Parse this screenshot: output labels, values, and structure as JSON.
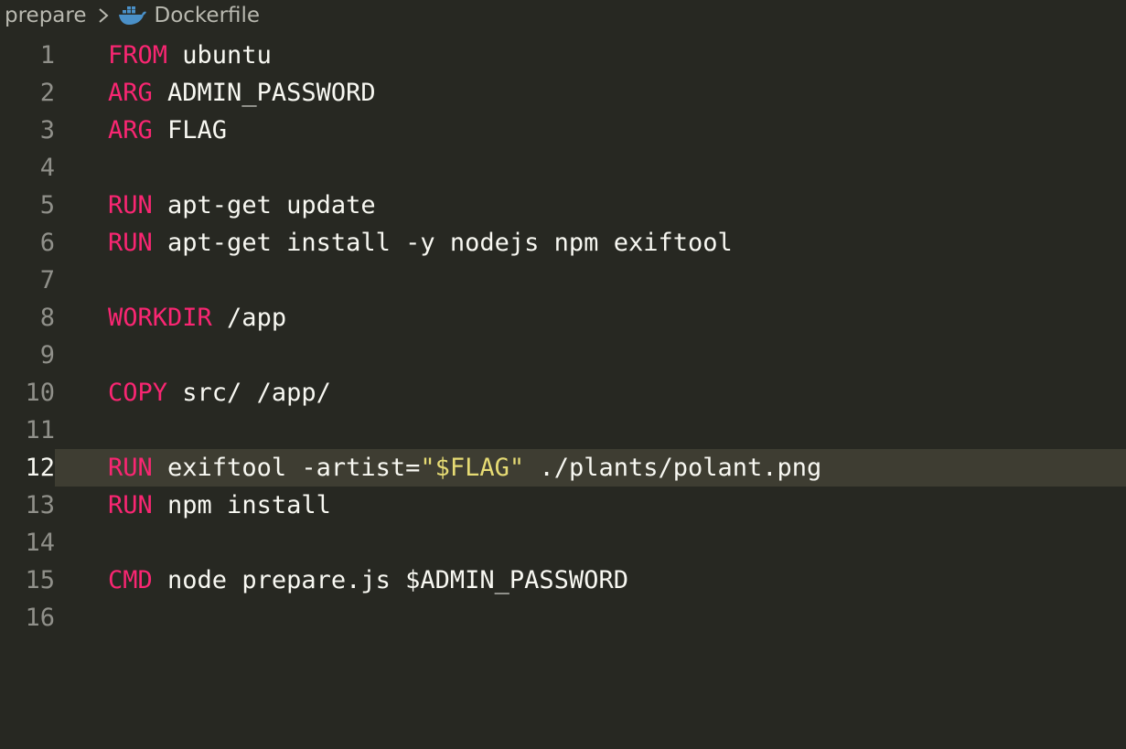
{
  "breadcrumb": {
    "folder": "prepare",
    "file": "Dockerfile"
  },
  "icons": {
    "separator": "chevron-right-icon",
    "file_type": "docker-icon"
  },
  "colors": {
    "background": "#272822",
    "keyword": "#f92672",
    "string": "#e6db74",
    "text": "#f8f8f2",
    "line_number": "#90908a",
    "current_line_highlight": "#3e3d32"
  },
  "editor": {
    "current_line": 12,
    "lines": [
      {
        "number": "1",
        "keyword": "FROM",
        "rest": " ubuntu"
      },
      {
        "number": "2",
        "keyword": "ARG",
        "rest": " ADMIN_PASSWORD"
      },
      {
        "number": "3",
        "keyword": "ARG",
        "rest": " FLAG"
      },
      {
        "number": "4",
        "keyword": "",
        "rest": ""
      },
      {
        "number": "5",
        "keyword": "RUN",
        "rest": " apt-get update"
      },
      {
        "number": "6",
        "keyword": "RUN",
        "rest": " apt-get install -y nodejs npm exiftool"
      },
      {
        "number": "7",
        "keyword": "",
        "rest": ""
      },
      {
        "number": "8",
        "keyword": "WORKDIR",
        "rest": " /app"
      },
      {
        "number": "9",
        "keyword": "",
        "rest": ""
      },
      {
        "number": "10",
        "keyword": "COPY",
        "rest": " src/ /app/"
      },
      {
        "number": "11",
        "keyword": "",
        "rest": ""
      },
      {
        "number": "12",
        "keyword": "RUN",
        "pre": " exiftool -artist=",
        "string": "\"$FLAG\"",
        "rest": " ./plants/polant.png"
      },
      {
        "number": "13",
        "keyword": "RUN",
        "rest": " npm install"
      },
      {
        "number": "14",
        "keyword": "",
        "rest": ""
      },
      {
        "number": "15",
        "keyword": "CMD",
        "rest": " node prepare.js $ADMIN_PASSWORD"
      },
      {
        "number": "16",
        "keyword": "",
        "rest": ""
      }
    ]
  }
}
